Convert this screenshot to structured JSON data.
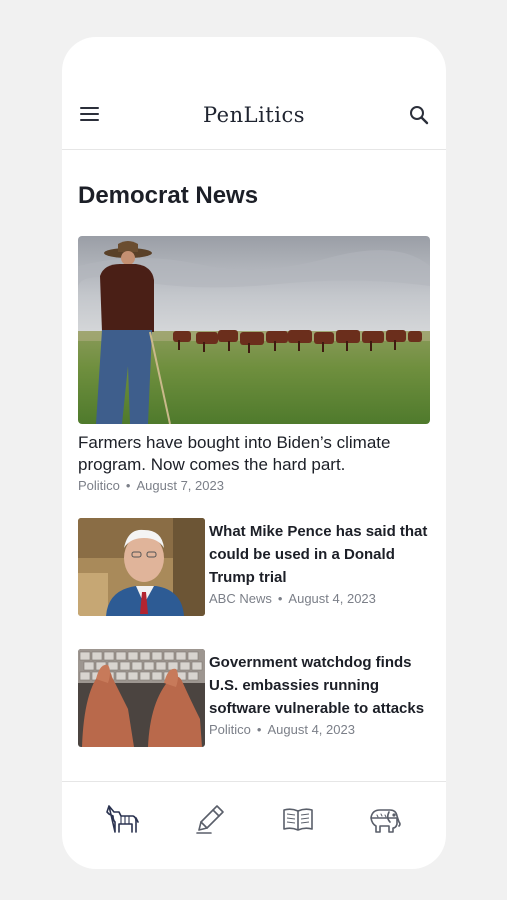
{
  "app": {
    "logo": "PenLitics"
  },
  "header": {
    "menu_icon": "hamburger-menu-icon",
    "search_icon": "search-icon"
  },
  "section": {
    "title": "Democrat News"
  },
  "feature": {
    "title": "Farmers have bought into Biden’s climate program. Now comes the hard part.",
    "source": "Politico",
    "date": "August 7, 2023"
  },
  "articles": [
    {
      "title": "What Mike Pence has said that could be used in a Donald Trump trial",
      "source": "ABC News",
      "date": "August 4, 2023"
    },
    {
      "title": "Government watchdog finds U.S. embassies running software vulnerable to attacks",
      "source": "Politico",
      "date": "August 4, 2023"
    }
  ],
  "bottom_nav": [
    {
      "icon": "donkey-icon",
      "active": true
    },
    {
      "icon": "pen-icon",
      "active": false
    },
    {
      "icon": "book-icon",
      "active": false
    },
    {
      "icon": "elephant-icon",
      "active": false
    }
  ],
  "colors": {
    "text": "#1c1f27",
    "meta": "#7b7f88",
    "nav_active": "#2b3350",
    "nav_inactive": "#5a5f6a"
  }
}
